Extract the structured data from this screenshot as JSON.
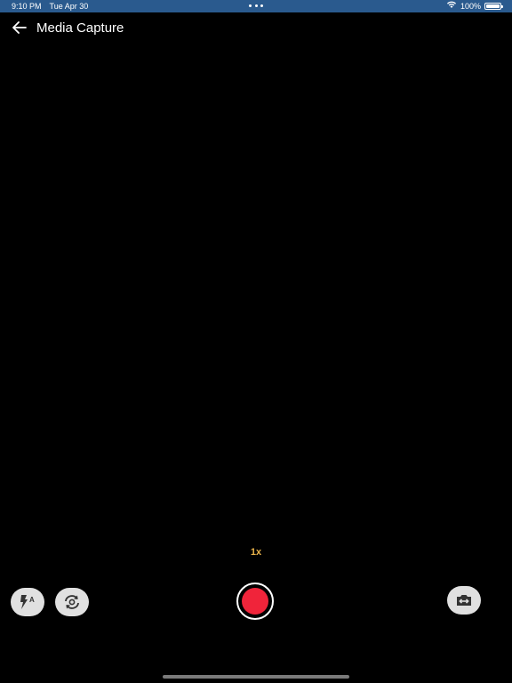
{
  "status_bar": {
    "time": "9:10 PM",
    "date": "Tue Apr 30",
    "battery_percent": "100%",
    "battery_level": 1.0,
    "icons": [
      "more-dots-icon",
      "wifi-icon",
      "battery-icon"
    ],
    "background_color": "#2a5a8e"
  },
  "header": {
    "title": "Media Capture",
    "back_icon": "back-arrow-icon"
  },
  "camera": {
    "zoom_label": "1x",
    "zoom_color": "#e8b24a",
    "controls": {
      "flash_icon": "flash-auto-icon",
      "switch_camera_icon": "switch-camera-icon",
      "shutter_icon": "record-icon",
      "shutter_color": "#f0243a",
      "mode_toggle_icon": "camera-swap-icon"
    }
  }
}
